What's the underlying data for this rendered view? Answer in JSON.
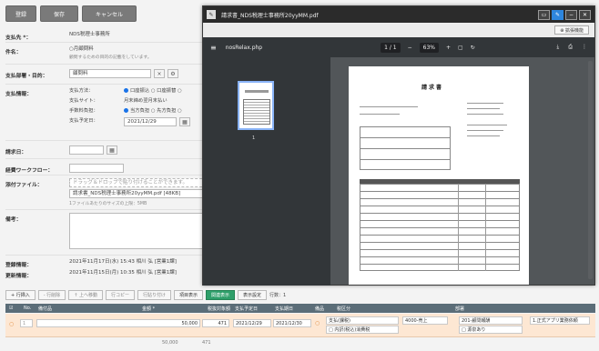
{
  "toolbar": {
    "btn1": "登録",
    "btn2": "保存",
    "btn3": "キャンセル"
  },
  "form": {
    "payee_label": "支払先 *：",
    "payee_value": "NDS税理士事務所",
    "subject_label": "件名：",
    "subject_value": "○月顧問料",
    "subject_hint": "顧問するための目的の記載をしています。",
    "dept_label": "支払部署・目的：",
    "dept_value": "顧問料",
    "dept_btn": "×",
    "payinfo_label": "支払情報：",
    "payinfo": [
      {
        "k": "支払方法：",
        "v": "口座振込 ○ 口座振替 ○"
      },
      {
        "k": "支払サイト：",
        "v": "月末締め翌月末払い"
      },
      {
        "k": "手数料負担：",
        "v": "当方負担 ○ 先方負担 ○"
      },
      {
        "k": "支払予定日：",
        "v": "2021/12/29"
      }
    ],
    "invoice_date_label": "請求日：",
    "workflow_label": "経費ワークフロー：",
    "file_label": "添付ファイル：",
    "file_drop": "ドラッグ＆ドロップで貼り付けることができます。",
    "file_name": "請求書_NDS税理士事務所20yyMM.pdf [48KB]",
    "file_note": "1ファイルあたりのサイズの上限：5MB",
    "note_label": "備考：",
    "created_label": "登録情報：",
    "created_value": "2021年11月17日(水) 15:43 相川 弘",
    "updated_label": "更新情報：",
    "updated_value": "2021年11月15日(月) 10:35 相川 弘",
    "created_tag": "[営業1課]",
    "updated_tag": "[営業1課]"
  },
  "pdf": {
    "window_title": "請求書_NDS税理士事務所20yyMM.pdf",
    "title_icon": "✎",
    "download_btn": "⊕ 拡張機能",
    "doc_name": "nosRelax.php",
    "page_indicator": "1 / 1",
    "zoom": "63%",
    "thumb_page": "1",
    "doc_title": "請求書"
  },
  "bottom": {
    "b1": "+ 行挿入",
    "b2": "- 行削除",
    "b3": "↑ 上へ移動",
    "b4": "行コピー",
    "b5": "行貼り付け",
    "b6": "項目表示",
    "b7": "関連表示",
    "b8": "表示設定",
    "count": "行数：1"
  },
  "grid": {
    "headers": [
      "No.",
      "備付品",
      "金額 *",
      "税抜対象額",
      "支払予定日",
      "支払期日",
      "備品",
      "税区分",
      "部署"
    ],
    "row": {
      "no": "1",
      "amount": "50,000",
      "tax": "471",
      "date1": "2021/12/29",
      "date2": "2021/12/30",
      "dept": "支払(課税)",
      "type": "4000-売上",
      "tax_class": "201-顧問報酬",
      "dept2": "1.正式アプリ業務依頼",
      "sub1": "□ 内訳(税込)消費税",
      "sub2": "□ 源泉あり"
    },
    "total_amount": "50,000",
    "total_tax": "471"
  }
}
